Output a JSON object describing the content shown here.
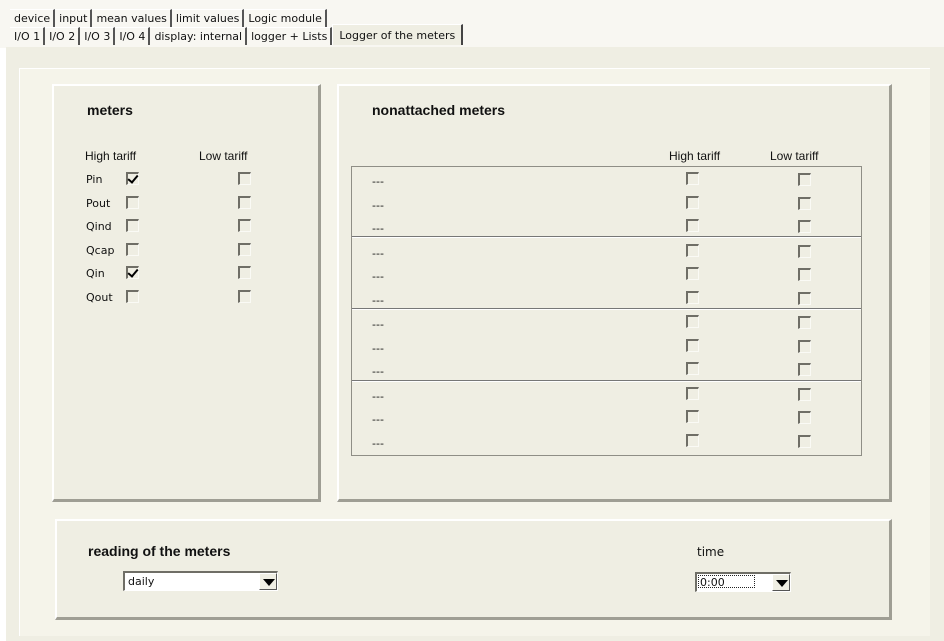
{
  "tabs": {
    "row1": [
      "device",
      "input",
      "mean values",
      "limit values",
      "Logic module"
    ],
    "row2": [
      "I/O 1",
      "I/O 2",
      "I/O 3",
      "I/O 4",
      "display: internal",
      "logger + Lists",
      "Logger of the meters"
    ]
  },
  "meters": {
    "title": "meters",
    "col_high": "High tariff",
    "col_low": "Low tariff",
    "rows": [
      {
        "label": "Pin",
        "high": true,
        "low": false
      },
      {
        "label": "Pout",
        "high": false,
        "low": false
      },
      {
        "label": "Qind",
        "high": false,
        "low": false
      },
      {
        "label": "Qcap",
        "high": false,
        "low": false
      },
      {
        "label": "Qin",
        "high": true,
        "low": false
      },
      {
        "label": "Qout",
        "high": false,
        "low": false
      }
    ]
  },
  "nonattached": {
    "title": "nonattached meters",
    "col_high": "High tariff",
    "col_low": "Low tariff",
    "row_label": "---",
    "row_count": 12
  },
  "reading": {
    "title": "reading of the meters",
    "interval_value": "daily",
    "time_label": "time",
    "time_value": "0:00"
  }
}
